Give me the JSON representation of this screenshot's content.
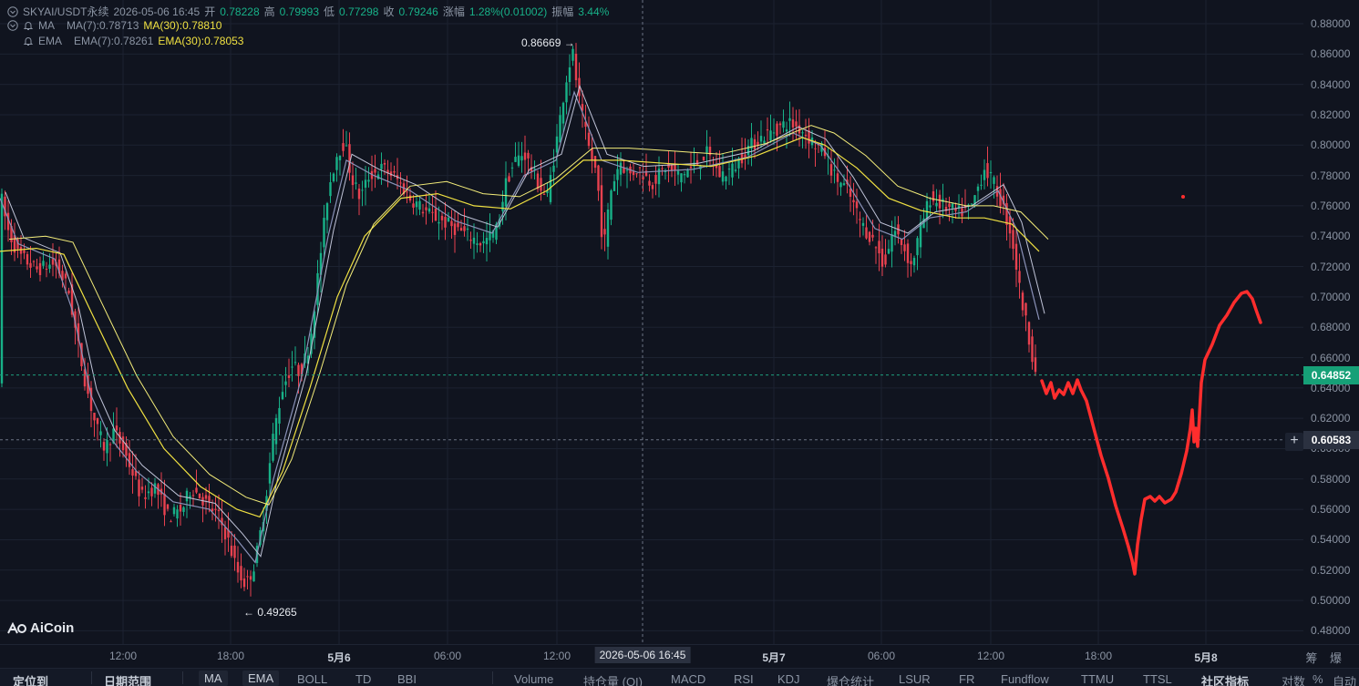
{
  "header": {
    "row1": {
      "symbol": "SKYAI/USDT永续",
      "datetime": "2026-05-06 16:45",
      "open_label": "开",
      "open": "0.78228",
      "high_label": "高",
      "high": "0.79993",
      "low_label": "低",
      "low": "0.77298",
      "close_label": "收",
      "close": "0.79246",
      "change_label": "涨幅",
      "change": "1.28%(0.01002)",
      "amp_label": "振幅",
      "amp": "3.44%"
    },
    "ma_row": {
      "name": "MA",
      "short": "MA(7):0.78713",
      "long": "MA(30):0.78810"
    },
    "ema_row": {
      "name": "EMA",
      "short": "EMA(7):0.78261",
      "long": "EMA(30):0.78053"
    }
  },
  "annotations": {
    "high": "0.86669 →",
    "low": "← 0.49265"
  },
  "logo": {
    "text": "AiCoin"
  },
  "price_axis": {
    "ticks": [
      "0.88000",
      "0.86000",
      "0.84000",
      "0.82000",
      "0.80000",
      "0.78000",
      "0.76000",
      "0.74000",
      "0.72000",
      "0.70000",
      "0.68000",
      "0.66000",
      "0.64000",
      "0.62000",
      "0.60000",
      "0.58000",
      "0.56000",
      "0.54000",
      "0.52000",
      "0.50000",
      "0.48000"
    ],
    "current_price": "0.64852",
    "crosshair_price": "0.60583"
  },
  "time_axis": {
    "ticks": [
      "12:00",
      "18:00",
      "5月6",
      "06:00",
      "12:00",
      "5月7",
      "06:00",
      "12:00",
      "18:00",
      "5月8"
    ],
    "crosshair_time": "2026-05-06 16:45",
    "settings": "筹 爆"
  },
  "toolbar": {
    "items": [
      "定位到",
      "日期范围",
      "MA",
      "EMA",
      "BOLL",
      "TD",
      "BBI",
      "Volume",
      "持仓量 (OI)",
      "MACD",
      "RSI",
      "KDJ",
      "爆仓统计",
      "LSUR",
      "FR",
      "Fundflow",
      "TTMU",
      "TTSL",
      "社区指标",
      "对数",
      "%",
      "自动"
    ]
  },
  "colors": {
    "background": "#10141f",
    "up_candle": "#18b188",
    "down_candle": "#e8414f",
    "ma_short": "#8a92b8",
    "ma_long": "#f0e142",
    "drawing": "#ff2d2d",
    "grid": "#1c2231"
  },
  "chart_data": {
    "type": "candlestick",
    "symbol": "SKYAI/USDT永续",
    "interval": "15m",
    "ylim": [
      0.48,
      0.88
    ],
    "highest": 0.86669,
    "lowest": 0.49265,
    "last_price": 0.64852,
    "price_path": [
      [
        0,
        0.77
      ],
      [
        8,
        0.745
      ],
      [
        20,
        0.728
      ],
      [
        40,
        0.718
      ],
      [
        60,
        0.722
      ],
      [
        75,
        0.705
      ],
      [
        85,
        0.67
      ],
      [
        95,
        0.64
      ],
      [
        105,
        0.615
      ],
      [
        115,
        0.6
      ],
      [
        125,
        0.612
      ],
      [
        135,
        0.6
      ],
      [
        145,
        0.585
      ],
      [
        155,
        0.568
      ],
      [
        170,
        0.575
      ],
      [
        185,
        0.555
      ],
      [
        200,
        0.56
      ],
      [
        210,
        0.575
      ],
      [
        225,
        0.565
      ],
      [
        240,
        0.555
      ],
      [
        250,
        0.54
      ],
      [
        260,
        0.52
      ],
      [
        270,
        0.51
      ],
      [
        280,
        0.525
      ],
      [
        290,
        0.56
      ],
      [
        300,
        0.61
      ],
      [
        310,
        0.64
      ],
      [
        320,
        0.655
      ],
      [
        330,
        0.65
      ],
      [
        340,
        0.67
      ],
      [
        350,
        0.72
      ],
      [
        360,
        0.77
      ],
      [
        370,
        0.795
      ],
      [
        378,
        0.802
      ],
      [
        385,
        0.78
      ],
      [
        395,
        0.765
      ],
      [
        405,
        0.78
      ],
      [
        420,
        0.785
      ],
      [
        435,
        0.778
      ],
      [
        450,
        0.765
      ],
      [
        470,
        0.755
      ],
      [
        485,
        0.75
      ],
      [
        500,
        0.745
      ],
      [
        515,
        0.74
      ],
      [
        530,
        0.735
      ],
      [
        545,
        0.745
      ],
      [
        555,
        0.775
      ],
      [
        565,
        0.79
      ],
      [
        575,
        0.795
      ],
      [
        590,
        0.775
      ],
      [
        600,
        0.765
      ],
      [
        610,
        0.8
      ],
      [
        620,
        0.84
      ],
      [
        628,
        0.862
      ],
      [
        635,
        0.83
      ],
      [
        645,
        0.8
      ],
      [
        655,
        0.78
      ],
      [
        662,
        0.73
      ],
      [
        670,
        0.77
      ],
      [
        680,
        0.79
      ],
      [
        690,
        0.78
      ],
      [
        700,
        0.785
      ],
      [
        715,
        0.775
      ],
      [
        730,
        0.785
      ],
      [
        745,
        0.78
      ],
      [
        760,
        0.785
      ],
      [
        775,
        0.795
      ],
      [
        790,
        0.78
      ],
      [
        805,
        0.785
      ],
      [
        820,
        0.798
      ],
      [
        835,
        0.805
      ],
      [
        850,
        0.81
      ],
      [
        865,
        0.815
      ],
      [
        880,
        0.81
      ],
      [
        895,
        0.8
      ],
      [
        905,
        0.795
      ],
      [
        915,
        0.78
      ],
      [
        930,
        0.77
      ],
      [
        945,
        0.748
      ],
      [
        960,
        0.735
      ],
      [
        970,
        0.72
      ],
      [
        980,
        0.745
      ],
      [
        990,
        0.735
      ],
      [
        1000,
        0.72
      ],
      [
        1010,
        0.745
      ],
      [
        1020,
        0.765
      ],
      [
        1035,
        0.76
      ],
      [
        1050,
        0.755
      ],
      [
        1065,
        0.758
      ],
      [
        1080,
        0.785
      ],
      [
        1090,
        0.775
      ],
      [
        1100,
        0.76
      ],
      [
        1110,
        0.74
      ],
      [
        1120,
        0.7
      ],
      [
        1130,
        0.67
      ],
      [
        1137,
        0.648
      ]
    ],
    "ma7": [
      [
        0,
        0.765
      ],
      [
        20,
        0.735
      ],
      [
        60,
        0.725
      ],
      [
        80,
        0.69
      ],
      [
        100,
        0.635
      ],
      [
        120,
        0.608
      ],
      [
        150,
        0.585
      ],
      [
        190,
        0.565
      ],
      [
        230,
        0.56
      ],
      [
        260,
        0.54
      ],
      [
        280,
        0.525
      ],
      [
        300,
        0.58
      ],
      [
        330,
        0.645
      ],
      [
        360,
        0.74
      ],
      [
        380,
        0.79
      ],
      [
        410,
        0.78
      ],
      [
        450,
        0.77
      ],
      [
        500,
        0.75
      ],
      [
        540,
        0.742
      ],
      [
        575,
        0.78
      ],
      [
        610,
        0.79
      ],
      [
        630,
        0.835
      ],
      [
        660,
        0.79
      ],
      [
        700,
        0.782
      ],
      [
        760,
        0.784
      ],
      [
        820,
        0.792
      ],
      [
        870,
        0.808
      ],
      [
        900,
        0.8
      ],
      [
        930,
        0.775
      ],
      [
        960,
        0.745
      ],
      [
        990,
        0.738
      ],
      [
        1020,
        0.752
      ],
      [
        1060,
        0.756
      ],
      [
        1095,
        0.77
      ],
      [
        1115,
        0.745
      ],
      [
        1140,
        0.685
      ]
    ],
    "ma30": [
      [
        0,
        0.73
      ],
      [
        40,
        0.732
      ],
      [
        70,
        0.728
      ],
      [
        100,
        0.69
      ],
      [
        140,
        0.64
      ],
      [
        180,
        0.6
      ],
      [
        220,
        0.575
      ],
      [
        260,
        0.56
      ],
      [
        285,
        0.555
      ],
      [
        310,
        0.585
      ],
      [
        340,
        0.64
      ],
      [
        370,
        0.7
      ],
      [
        400,
        0.74
      ],
      [
        440,
        0.765
      ],
      [
        480,
        0.768
      ],
      [
        520,
        0.76
      ],
      [
        560,
        0.758
      ],
      [
        600,
        0.77
      ],
      [
        640,
        0.79
      ],
      [
        680,
        0.79
      ],
      [
        730,
        0.788
      ],
      [
        780,
        0.786
      ],
      [
        830,
        0.793
      ],
      [
        880,
        0.805
      ],
      [
        905,
        0.8
      ],
      [
        940,
        0.785
      ],
      [
        975,
        0.765
      ],
      [
        1010,
        0.757
      ],
      [
        1050,
        0.752
      ],
      [
        1080,
        0.752
      ],
      [
        1110,
        0.748
      ],
      [
        1140,
        0.73
      ]
    ]
  }
}
